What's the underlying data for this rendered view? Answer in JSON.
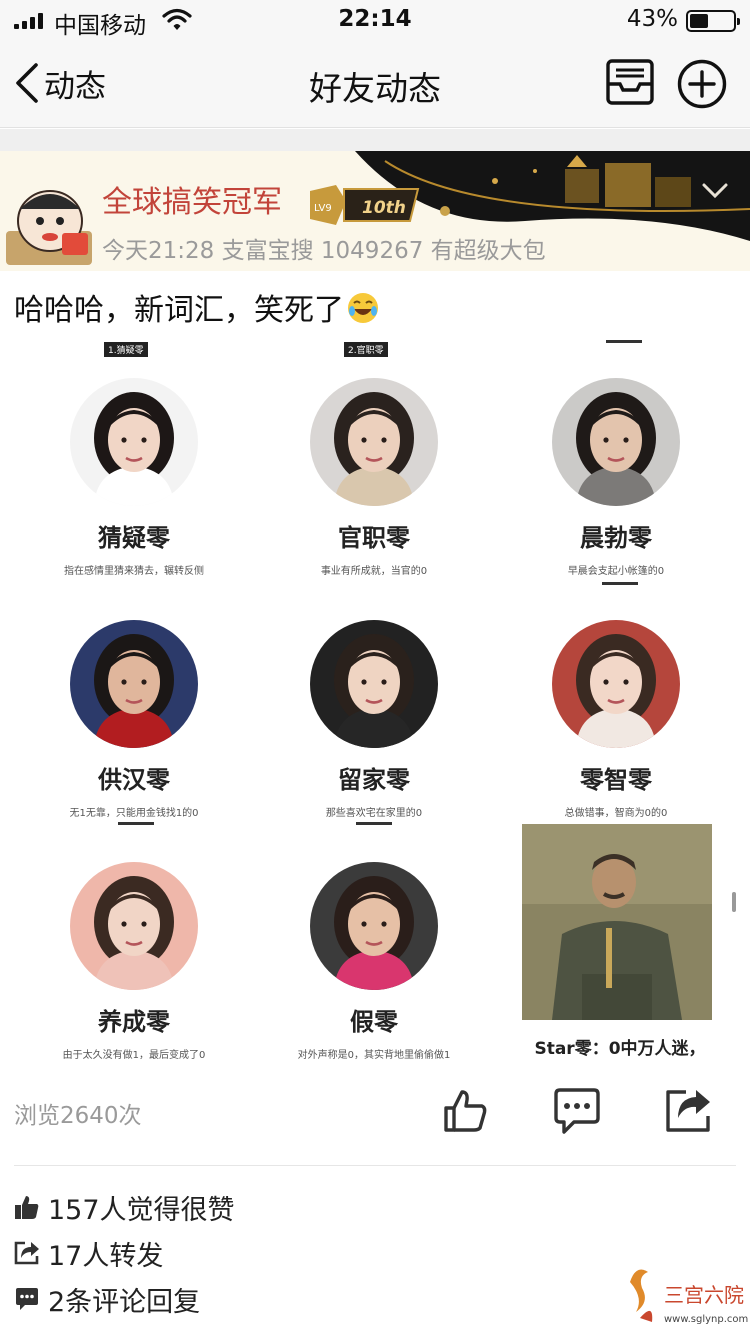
{
  "status_bar": {
    "carrier": "中国移动",
    "time": "22:14",
    "battery_percent_text": "43%",
    "battery_level": 0.43
  },
  "nav": {
    "back_label": "动态",
    "title": "好友动态",
    "mail_icon": "mail-tray-icon",
    "add_icon": "plus-circle-icon"
  },
  "post": {
    "author": "全球搞笑冠军",
    "level_badge": "LV9",
    "anniversary_badge": "10th",
    "meta": "今天21:28  支富宝搜 1049267 有超级大包",
    "text": "哈哈哈，新词汇，笑死了",
    "emoji": "tears-of-joy",
    "image": {
      "cells": [
        {
          "tag": "1.猜疑零",
          "title": "猜疑零",
          "desc": "指在感情里猜来猜去，辗转反侧",
          "skin": "#f1d6c6",
          "hair": "#1d1716",
          "bg": "#f3f3f3",
          "cloth": "#ffffff"
        },
        {
          "tag": "2.官职零",
          "title": "官职零",
          "desc": "事业有所成就，当官的0",
          "skin": "#ecd0bd",
          "hair": "#2a221e",
          "bg": "#d9d6d4",
          "cloth": "#d9c7ad"
        },
        {
          "tag": "",
          "title": "晨勃零",
          "desc": "早晨会支起小帐篷的0",
          "skin": "#e3c4ad",
          "hair": "#1f1a18",
          "bg": "#cbcac8",
          "cloth": "#7c7a78"
        },
        {
          "tag": "",
          "title": "供汉零",
          "desc": "无1无靠，只能用金钱找1的0",
          "skin": "#e0b69c",
          "hair": "#1b1716",
          "bg": "#2c3a6a",
          "cloth": "#b21d20"
        },
        {
          "tag": "",
          "title": "留家零",
          "desc": "那些喜欢宅在家里的0",
          "skin": "#efd4c2",
          "hair": "#2a211c",
          "bg": "#222222",
          "cloth": "#262626"
        },
        {
          "tag": "",
          "title": "零智零",
          "desc": "总做错事，智商为0的0",
          "skin": "#f2d7c8",
          "hair": "#3a2a22",
          "bg": "#b5463c",
          "cloth": "#f1e8e2"
        },
        {
          "tag": "",
          "title": "养成零",
          "desc": "由于太久没有做1，最后变成了0",
          "skin": "#f1d5c6",
          "hair": "#3b2a22",
          "bg": "#efb7aa",
          "cloth": "#efc2b8"
        },
        {
          "tag": "",
          "title": "假零",
          "desc": "对外声称是0，其实背地里偷偷做1",
          "skin": "#e6c0a6",
          "hair": "#2a1e1a",
          "bg": "#3b3b3b",
          "cloth": "#d9366e"
        }
      ],
      "last_caption": "Star零：0中万人迷，"
    }
  },
  "stats": {
    "views": "浏览2640次",
    "likes": "157人觉得很赞",
    "shares": "17人转发",
    "comments": "2条评论回复"
  },
  "watermark": {
    "name": "三宫六院",
    "url": "www.sglynp.com"
  },
  "colors": {
    "accent_name": "#c2443a",
    "meta_gray": "#9a9a9a",
    "bar_bg": "#f7f7f7"
  }
}
